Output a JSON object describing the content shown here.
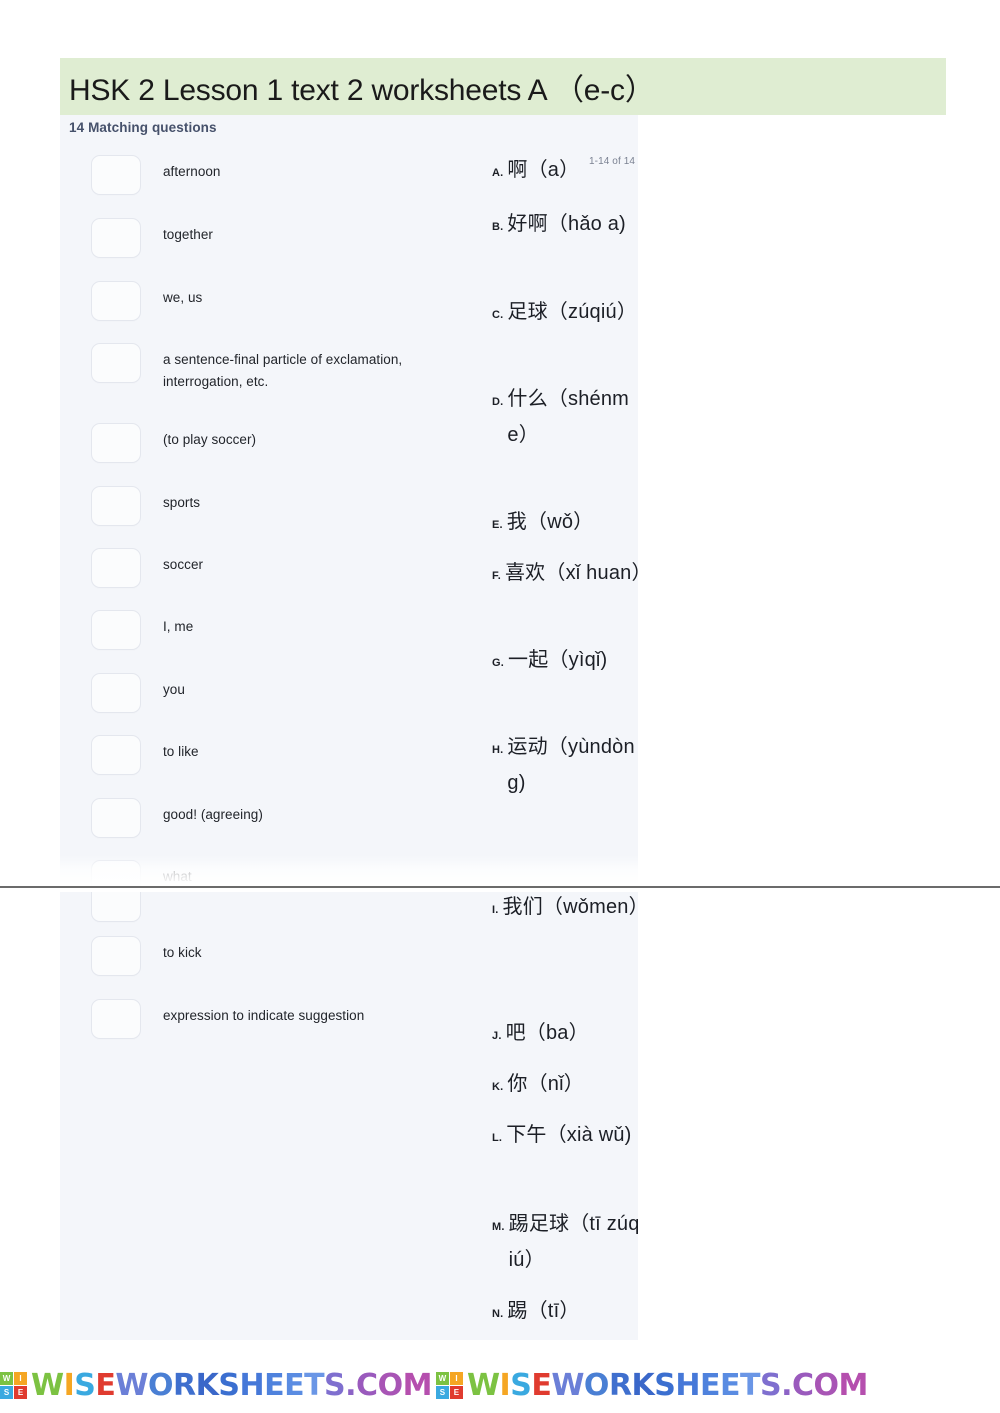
{
  "header": {
    "title": "HSK 2 Lesson 1 text 2 worksheets A （e-c）",
    "banner_color": "#dfedd2"
  },
  "worksheet": {
    "subtitle": "14 Matching questions",
    "counter": "1-14 of 14",
    "panel_color": "#f4f6fa",
    "prompts": [
      {
        "text": "afternoon"
      },
      {
        "text": "together"
      },
      {
        "text": "we, us"
      },
      {
        "text": "a sentence-final particle of exclamation, interrogation, etc."
      },
      {
        "text": " (to play soccer)"
      },
      {
        "text": "sports"
      },
      {
        "text": "soccer"
      },
      {
        "text": "I, me"
      },
      {
        "text": "you"
      },
      {
        "text": "to like"
      },
      {
        "text": "good! (agreeing)"
      },
      {
        "text": "what"
      },
      {
        "text": ""
      },
      {
        "text": "to kick"
      },
      {
        "text": "expression to indicate suggestion"
      }
    ],
    "options": [
      {
        "letter": "A.",
        "text": "啊（a）"
      },
      {
        "letter": "B.",
        "text": "好啊（hǎo a)"
      },
      {
        "letter": "C.",
        "text": "足球（zúqiú）"
      },
      {
        "letter": "D.",
        "text": "什么（shénme）"
      },
      {
        "letter": "E.",
        "text": "我（wǒ）"
      },
      {
        "letter": "F.",
        "text": "喜欢（xǐ huan）"
      },
      {
        "letter": "G.",
        "text": "一起（yìqǐ)"
      },
      {
        "letter": "H.",
        "text": "运动（yùndòng)"
      },
      {
        "letter": "I.",
        "text": "我们（wǒmen）"
      },
      {
        "letter": "J.",
        "text": "吧（ba）"
      },
      {
        "letter": "K.",
        "text": "你（nǐ）"
      },
      {
        "letter": "L.",
        "text": "下午（xià wǔ)"
      },
      {
        "letter": "M.",
        "text": "踢足球（tī zúqiú）"
      },
      {
        "letter": "N.",
        "text": "踢（tī）"
      }
    ]
  },
  "watermark": {
    "tile_letters": [
      "W",
      "I",
      "S",
      "E"
    ],
    "tile_colors": [
      "#7cc242",
      "#f5a623",
      "#3aa9e0",
      "#e03b2f"
    ],
    "word": "WISEWORKSHEETS.COM",
    "letter_colors": [
      "#7cc242",
      "#f5a623",
      "#3aa9e0",
      "#e03b2f",
      "#6b7fd7",
      "#4a7fd4",
      "#3f6fce",
      "#3a67c9",
      "#3b6fd0",
      "#4678d8",
      "#4f82dd",
      "#5a8ce2",
      "#6a96e6",
      "#7f6fcf",
      "#8c63c6",
      "#9a5abd",
      "#a855b5",
      "#b54fae"
    ]
  }
}
